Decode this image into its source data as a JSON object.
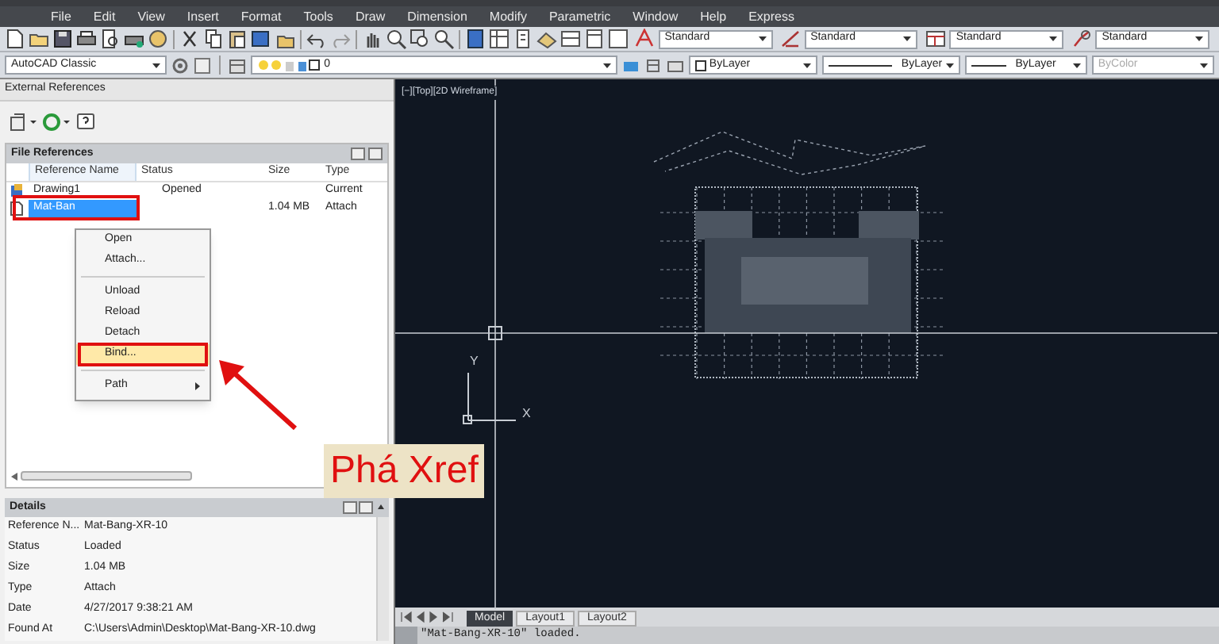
{
  "menu_bar": [
    "File",
    "Edit",
    "View",
    "Insert",
    "Format",
    "Tools",
    "Draw",
    "Dimension",
    "Modify",
    "Parametric",
    "Window",
    "Help",
    "Express"
  ],
  "style_dropdowns": [
    {
      "value": "Standard"
    },
    {
      "value": "Standard"
    },
    {
      "value": "Standard"
    },
    {
      "value": "Standard"
    }
  ],
  "workspace_dropdown": {
    "value": "AutoCAD Classic"
  },
  "layer_dropdown": {
    "value": "0"
  },
  "property_dropdowns": [
    {
      "value": "ByLayer",
      "disabled": false
    },
    {
      "value": "ByLayer",
      "disabled": false
    },
    {
      "value": "ByLayer",
      "disabled": false
    },
    {
      "value": "ByColor",
      "disabled": true
    }
  ],
  "xref_panel": {
    "title": "External References",
    "file_references": {
      "title": "File References",
      "columns": [
        "Reference Name",
        "Status",
        "Size",
        "Type"
      ],
      "rows": [
        {
          "name": "Drawing1",
          "status": "Opened",
          "size": "",
          "type": "Current",
          "selected": false
        },
        {
          "name": "Mat-Ban",
          "status": "",
          "size": "1.04 MB",
          "type": "Attach",
          "selected": true
        }
      ]
    },
    "context_menu": [
      {
        "label": "Open",
        "kind": "item",
        "selected": false
      },
      {
        "label": "Attach...",
        "kind": "item",
        "selected": false
      },
      {
        "kind": "separator"
      },
      {
        "label": "Unload",
        "kind": "item",
        "selected": false
      },
      {
        "label": "Reload",
        "kind": "item",
        "selected": false
      },
      {
        "label": "Detach",
        "kind": "item",
        "selected": false
      },
      {
        "label": "Bind...",
        "kind": "item",
        "selected": true
      },
      {
        "kind": "separator"
      },
      {
        "label": "Path",
        "kind": "submenu",
        "selected": false
      }
    ],
    "details": {
      "title": "Details",
      "rows": [
        {
          "label": "Reference N...",
          "value": "Mat-Bang-XR-10"
        },
        {
          "label": "Status",
          "value": "Loaded"
        },
        {
          "label": "Size",
          "value": "1.04 MB"
        },
        {
          "label": "Type",
          "value": "Attach"
        },
        {
          "label": "Date",
          "value": "4/27/2017 9:38:21 AM"
        },
        {
          "label": "Found At",
          "value": "C:\\Users\\Admin\\Desktop\\Mat-Bang-XR-10.dwg"
        }
      ]
    }
  },
  "viewport": {
    "label": "[−][Top][2D Wireframe]",
    "ucs_x": "X",
    "ucs_y": "Y"
  },
  "layout_tabs": [
    {
      "label": "Model",
      "selected": true
    },
    {
      "label": "Layout1",
      "selected": false
    },
    {
      "label": "Layout2",
      "selected": false
    }
  ],
  "command_line": "\"Mat-Bang-XR-10\" loaded.",
  "annotation": {
    "label": "Phá Xref"
  }
}
